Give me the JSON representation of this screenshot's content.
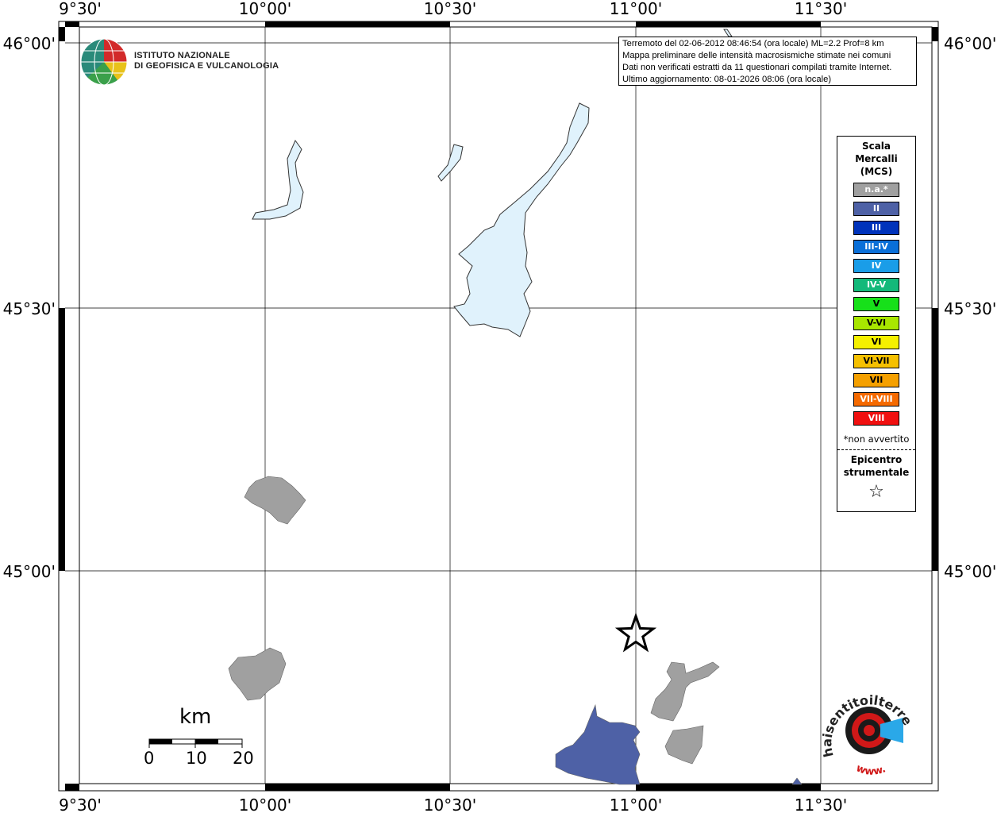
{
  "map": {
    "lon_labels": [
      "9°30'",
      "10°00'",
      "10°30'",
      "11°00'",
      "11°30'"
    ],
    "lat_labels": [
      "46°00'",
      "45°30'",
      "45°00'"
    ]
  },
  "logo": {
    "line1": "ISTITUTO NAZIONALE",
    "line2": "DI GEOFISICA E VULCANOLOGIA"
  },
  "info": {
    "line1": "Terremoto del 02-06-2012 08:46:54 (ora locale) ML=2.2 Prof=8 km",
    "line2": "Mappa preliminare delle intensità macrosismiche stimate nei comuni",
    "line3": "Dati non verificati estratti da 11 questionari compilati tramite Internet.",
    "line4": "Ultimo aggiornamento: 08-01-2026 08:06 (ora locale)"
  },
  "legend": {
    "title_line1": "Scala",
    "title_line2": "Mercalli",
    "title_line3": "(MCS)",
    "items": [
      {
        "label": "n.a.*",
        "color": "#a0a0a0"
      },
      {
        "label": "II",
        "color": "#4e61a6"
      },
      {
        "label": "III",
        "color": "#0033bb"
      },
      {
        "label": "III-IV",
        "color": "#0a6fd8"
      },
      {
        "label": "IV",
        "color": "#1a9de8"
      },
      {
        "label": "IV-V",
        "color": "#13b97a"
      },
      {
        "label": "V",
        "color": "#17e01a"
      },
      {
        "label": "V-VI",
        "color": "#a8e600"
      },
      {
        "label": "VI",
        "color": "#f5f000"
      },
      {
        "label": "VI-VII",
        "color": "#f5c000"
      },
      {
        "label": "VII",
        "color": "#f5a000"
      },
      {
        "label": "VII-VIII",
        "color": "#f56a00"
      },
      {
        "label": "VIII",
        "color": "#f01010"
      }
    ],
    "note": "*non avvertito",
    "epicentre_line1": "Epicentro",
    "epicentre_line2": "strumentale",
    "epicentre_symbol": "☆"
  },
  "scale_bar": {
    "title": "km",
    "labels": [
      "0",
      "10",
      "20"
    ]
  },
  "hsit": {
    "text": "haisentitoilterremoto.it",
    "www": "www."
  },
  "colors": {
    "water": "#e0f2fc",
    "grey_area": "#a0a0a0",
    "blue_area": "#4e61a6"
  }
}
